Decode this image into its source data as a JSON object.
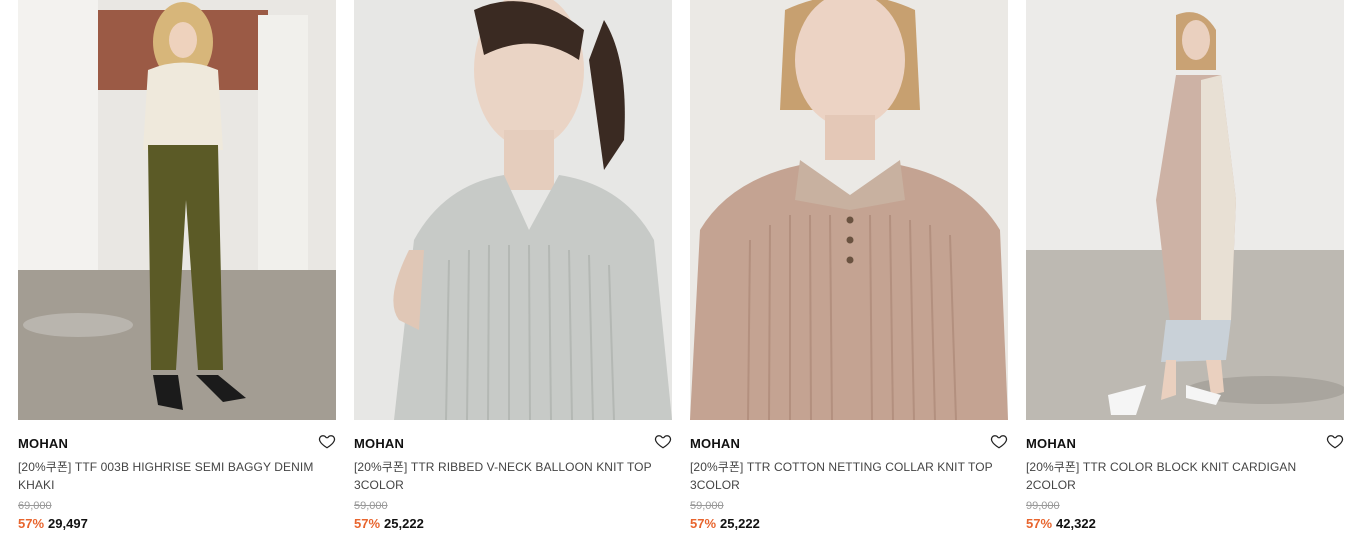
{
  "products": [
    {
      "brand": "MOHAN",
      "name": "[20%쿠폰] TTF 003B HIGHRISE SEMI BAGGY DENIM KHAKI",
      "original_price": "69,000",
      "discount": "57%",
      "sale_price": "29,497",
      "wishlist_icon": "heart-outline-icon",
      "colors": {
        "background": "#a9a39a",
        "garment_top": "#efe9dc",
        "garment_bottom": "#5b5a26"
      }
    },
    {
      "brand": "MOHAN",
      "name": "[20%쿠폰] TTR RIBBED V-NECK BALLOON KNIT TOP 3COLOR",
      "original_price": "59,000",
      "discount": "57%",
      "sale_price": "25,222",
      "wishlist_icon": "heart-outline-icon",
      "colors": {
        "background": "#e7e7e5",
        "garment_top": "#c7cac7"
      }
    },
    {
      "brand": "MOHAN",
      "name": "[20%쿠폰] TTR COTTON NETTING COLLAR KNIT TOP 3COLOR",
      "original_price": "59,000",
      "discount": "57%",
      "sale_price": "25,222",
      "wishlist_icon": "heart-outline-icon",
      "colors": {
        "background": "#ebe9e5",
        "garment_top": "#c4a392"
      }
    },
    {
      "brand": "MOHAN",
      "name": "[20%쿠폰] TTR COLOR BLOCK KNIT CARDIGAN 2COLOR",
      "original_price": "99,000",
      "discount": "57%",
      "sale_price": "42,322",
      "wishlist_icon": "heart-outline-icon",
      "colors": {
        "background": "#dedcd8",
        "garment_top": "#cdb2a5"
      }
    }
  ],
  "accent_color": "#e8652e"
}
